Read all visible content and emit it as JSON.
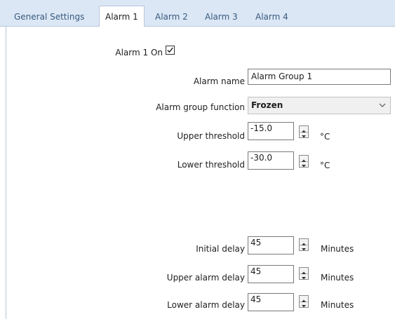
{
  "tabs": [
    {
      "label": "General Settings",
      "active": false
    },
    {
      "label": "Alarm 1",
      "active": true
    },
    {
      "label": "Alarm 2",
      "active": false
    },
    {
      "label": "Alarm 3",
      "active": false
    },
    {
      "label": "Alarm 4",
      "active": false
    }
  ],
  "alarm_on": {
    "label": "Alarm 1 On",
    "checked": true
  },
  "alarm_name": {
    "label": "Alarm name",
    "value": "Alarm Group 1"
  },
  "group_function": {
    "label": "Alarm group function",
    "value": "Frozen"
  },
  "upper_threshold": {
    "label": "Upper threshold",
    "value": "-15.0",
    "unit": "°C"
  },
  "lower_threshold": {
    "label": "Lower threshold",
    "value": "-30.0",
    "unit": "°C"
  },
  "initial_delay": {
    "label": "Initial delay",
    "value": "45",
    "unit": "Minutes"
  },
  "upper_alarm_delay": {
    "label": "Upper alarm delay",
    "value": "45",
    "unit": "Minutes"
  },
  "lower_alarm_delay": {
    "label": "Lower alarm delay",
    "value": "45",
    "unit": "Minutes"
  },
  "colors": {
    "tabbar_bg": "#dbe7f5",
    "tab_text": "#3a5a7d",
    "border": "#b7c7da"
  }
}
